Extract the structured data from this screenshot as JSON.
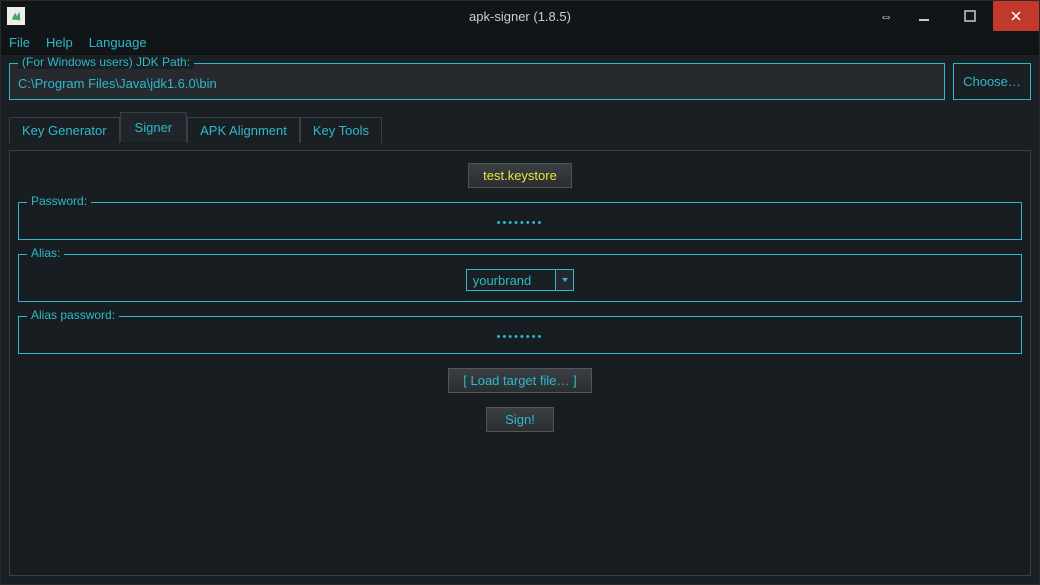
{
  "window": {
    "title": "apk-signer (1.8.5)"
  },
  "menu": {
    "file": "File",
    "help": "Help",
    "language": "Language"
  },
  "jdk": {
    "legend": "(For Windows users) JDK Path:",
    "path": "C:\\Program Files\\Java\\jdk1.6.0\\bin",
    "choose": "Choose…"
  },
  "tabs": {
    "keygen": "Key Generator",
    "signer": "Signer",
    "align": "APK Alignment",
    "tools": "Key Tools"
  },
  "signer": {
    "keystore_btn": "test.keystore",
    "password_legend": "Password:",
    "password_dots": "••••••••",
    "alias_legend": "Alias:",
    "alias_value": "yourbrand",
    "alias_pw_legend": "Alias password:",
    "alias_pw_dots": "••••••••",
    "load_btn": "[ Load target file… ]",
    "sign_btn": "Sign!"
  }
}
